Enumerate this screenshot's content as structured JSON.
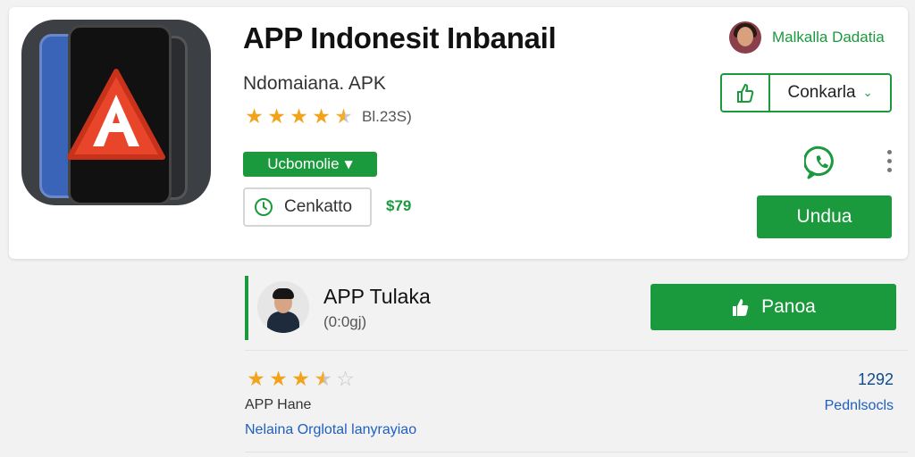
{
  "app": {
    "title": "APP Indonesit Inbanail",
    "subtitle": "Ndomaiana. APK",
    "rating_text": "Bl.23S)",
    "rating_stars": 4.5,
    "category_label": "Ucbomolie",
    "contact_label": "Cenkatto",
    "price": "$79"
  },
  "developer": {
    "name": "Malkalla Dadatia"
  },
  "split_button": {
    "label": "Conkarla"
  },
  "download_button": {
    "label": "Undua"
  },
  "review": {
    "reviewer_name": "APP Tulaka",
    "reviewer_meta": "(0:0gj)",
    "action_label": "Panoa",
    "stars": 3.5,
    "count": "1292",
    "label": "APP Hane",
    "link_right": "Pednlsocls",
    "link_text": "Nelaina Orglotal  lanyrayiao"
  },
  "icons": {
    "app_icon": "app-logo-icon",
    "clock": "clock-icon",
    "thumbs_up": "thumbs-up-icon",
    "whatsapp": "whatsapp-icon",
    "more": "more-vert-icon",
    "chevron": "chevron-down-icon"
  },
  "colors": {
    "accent": "#1a9a3c",
    "star": "#f2a31c",
    "link": "#1f5fbf"
  }
}
